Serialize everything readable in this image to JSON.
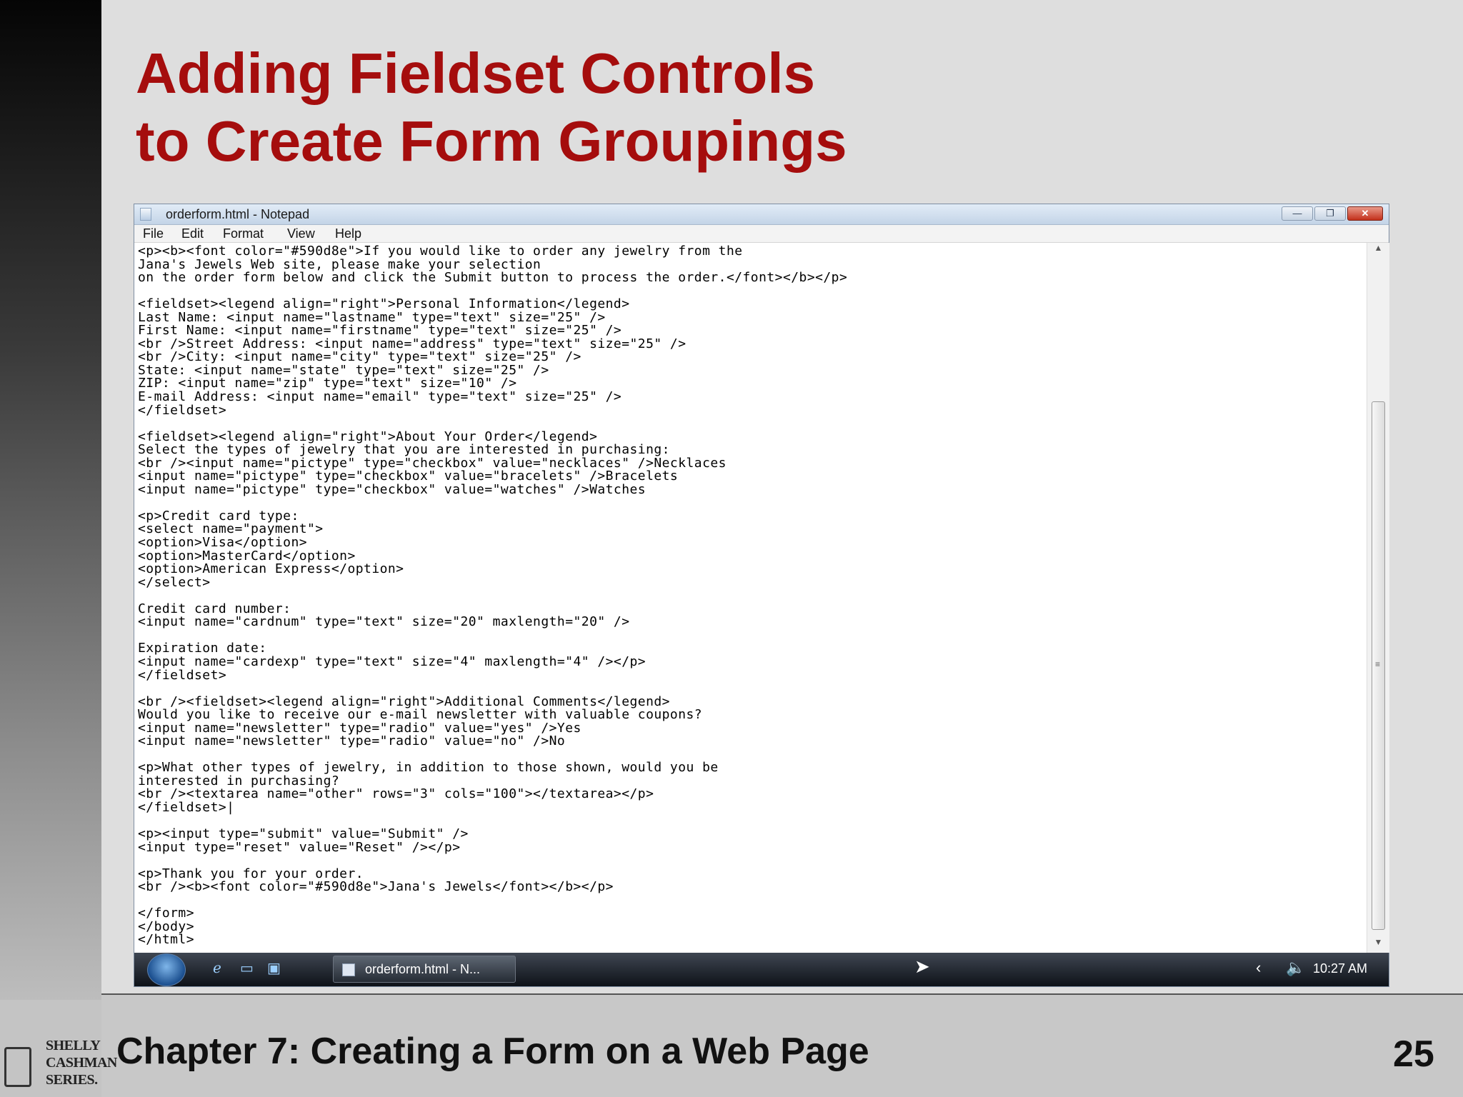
{
  "slide": {
    "title_line1": "Adding Fieldset Controls",
    "title_line2": "to Create Form Groupings",
    "footer_chapter": "Chapter 7: Creating a Form on a Web Page",
    "page_number": "25",
    "logo_lines": [
      "SHELLY",
      "CASHMAN",
      "SERIES."
    ],
    "title_color": "#a50d0d"
  },
  "window": {
    "title": "orderform.html - Notepad",
    "controls": {
      "minimize": "—",
      "maximize": "❐",
      "close": "✕"
    }
  },
  "menu": [
    "File",
    "Edit",
    "Format",
    "View",
    "Help"
  ],
  "editor": {
    "lines": [
      "<p><b><font color=\"#590d8e\">If you would like to order any jewelry from the",
      "Jana's Jewels Web site, please make your selection",
      "on the order form below and click the Submit button to process the order.</font></b></p>",
      "",
      "<fieldset><legend align=\"right\">Personal Information</legend>",
      "Last Name: <input name=\"lastname\" type=\"text\" size=\"25\" />",
      "First Name: <input name=\"firstname\" type=\"text\" size=\"25\" />",
      "<br />Street Address: <input name=\"address\" type=\"text\" size=\"25\" />",
      "<br />City: <input name=\"city\" type=\"text\" size=\"25\" />",
      "State: <input name=\"state\" type=\"text\" size=\"25\" />",
      "ZIP: <input name=\"zip\" type=\"text\" size=\"10\" />",
      "E-mail Address: <input name=\"email\" type=\"text\" size=\"25\" />",
      "</fieldset>",
      "",
      "<fieldset><legend align=\"right\">About Your Order</legend>",
      "Select the types of jewelry that you are interested in purchasing:",
      "<br /><input name=\"pictype\" type=\"checkbox\" value=\"necklaces\" />Necklaces",
      "<input name=\"pictype\" type=\"checkbox\" value=\"bracelets\" />Bracelets",
      "<input name=\"pictype\" type=\"checkbox\" value=\"watches\" />Watches",
      "",
      "<p>Credit card type:",
      "<select name=\"payment\">",
      "<option>Visa</option>",
      "<option>MasterCard</option>",
      "<option>American Express</option>",
      "</select>",
      "",
      "Credit card number:",
      "<input name=\"cardnum\" type=\"text\" size=\"20\" maxlength=\"20\" />",
      "",
      "Expiration date:",
      "<input name=\"cardexp\" type=\"text\" size=\"4\" maxlength=\"4\" /></p>",
      "</fieldset>",
      "",
      "<br /><fieldset><legend align=\"right\">Additional Comments</legend>",
      "Would you like to receive our e-mail newsletter with valuable coupons?",
      "<input name=\"newsletter\" type=\"radio\" value=\"yes\" />Yes",
      "<input name=\"newsletter\" type=\"radio\" value=\"no\" />No",
      "",
      "<p>What other types of jewelry, in addition to those shown, would you be",
      "interested in purchasing?",
      "<br /><textarea name=\"other\" rows=\"3\" cols=\"100\"></textarea></p>",
      "</fieldset>|",
      "",
      "<p><input type=\"submit\" value=\"Submit\" />",
      "<input type=\"reset\" value=\"Reset\" /></p>",
      "",
      "<p>Thank you for your order.",
      "<br /><b><font color=\"#590d8e\">Jana's Jewels</font></b></p>",
      "",
      "</form>",
      "</body>",
      "</html>"
    ]
  },
  "taskbar": {
    "task_label": "orderform.html - N...",
    "clock": "10:27 AM"
  },
  "icons": {
    "start": "windows-orb",
    "ie": "internet-explorer-icon",
    "desktop": "show-desktop-icon",
    "switch": "switch-windows-icon",
    "volume": "speaker-icon"
  }
}
